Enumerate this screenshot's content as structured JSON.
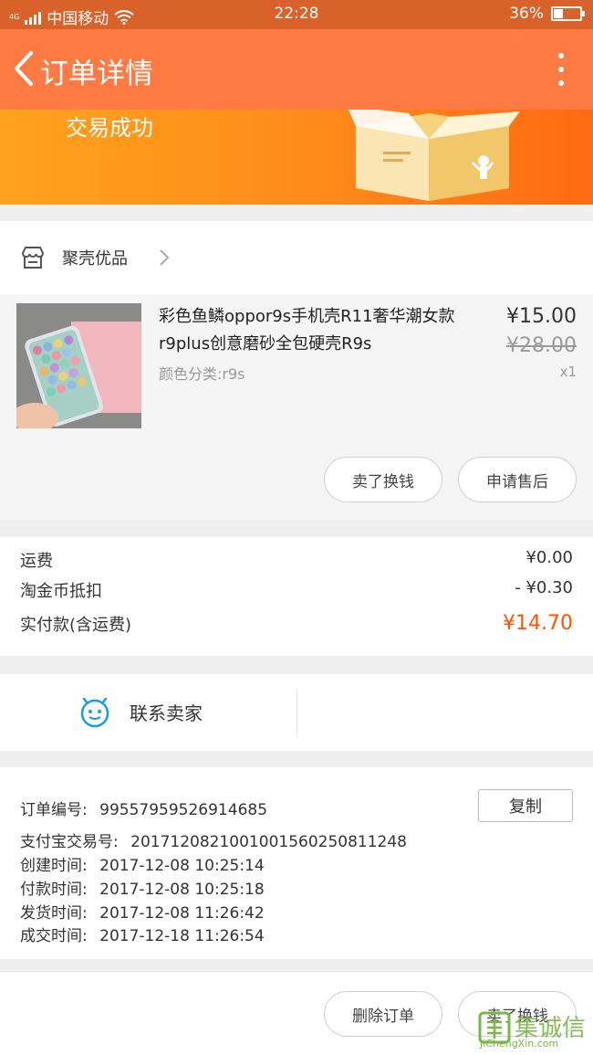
{
  "status_bar": {
    "network": "4G",
    "carrier": "中国移动",
    "time": "22:28",
    "battery": "36%",
    "battery_level": 0.36
  },
  "header": {
    "title": "订单详情",
    "back_icon": "chevron-left-icon",
    "more_icon": "more-vertical-icon"
  },
  "banner": {
    "status": "交易成功"
  },
  "shop": {
    "name": "聚壳优品"
  },
  "item": {
    "name": "彩色鱼鳞oppor9s手机壳R11奢华潮女款r9plus创意磨砂全包硬壳R9s",
    "spec": "颜色分类:r9s",
    "price": "¥15.00",
    "original_price": "¥28.00",
    "quantity": "x1",
    "actions": [
      "卖了换钱",
      "申请售后"
    ]
  },
  "payment": {
    "rows": [
      {
        "label": "运费",
        "value": "¥0.00"
      },
      {
        "label": "淘金币抵扣",
        "value": "- ¥0.30"
      },
      {
        "label": "实付款(含运费)",
        "value": "¥14.70"
      }
    ]
  },
  "contact": {
    "label": "联系卖家"
  },
  "order_info": {
    "order_no_label": "订单编号:",
    "order_no": "99557959526914685",
    "copy_label": "复制",
    "lines": [
      {
        "label": "支付宝交易号:",
        "value": "2017120821001001560250811248"
      },
      {
        "label": "创建时间:",
        "value": "2017-12-08 10:25:14"
      },
      {
        "label": "付款时间:",
        "value": "2017-12-08 10:25:18"
      },
      {
        "label": "发货时间:",
        "value": "2017-12-08 11:26:42"
      },
      {
        "label": "成交时间:",
        "value": "2017-12-18 11:26:54"
      }
    ]
  },
  "bottom_bar": {
    "delete_label": "删除订单",
    "sell_label": "卖了换钱"
  },
  "watermark": {
    "name": "集诚信",
    "url": "JiChengXin.com"
  },
  "colors": {
    "header": "#ff7b43",
    "status_bar": "#d9622b",
    "accent_price": "#ff5500"
  }
}
